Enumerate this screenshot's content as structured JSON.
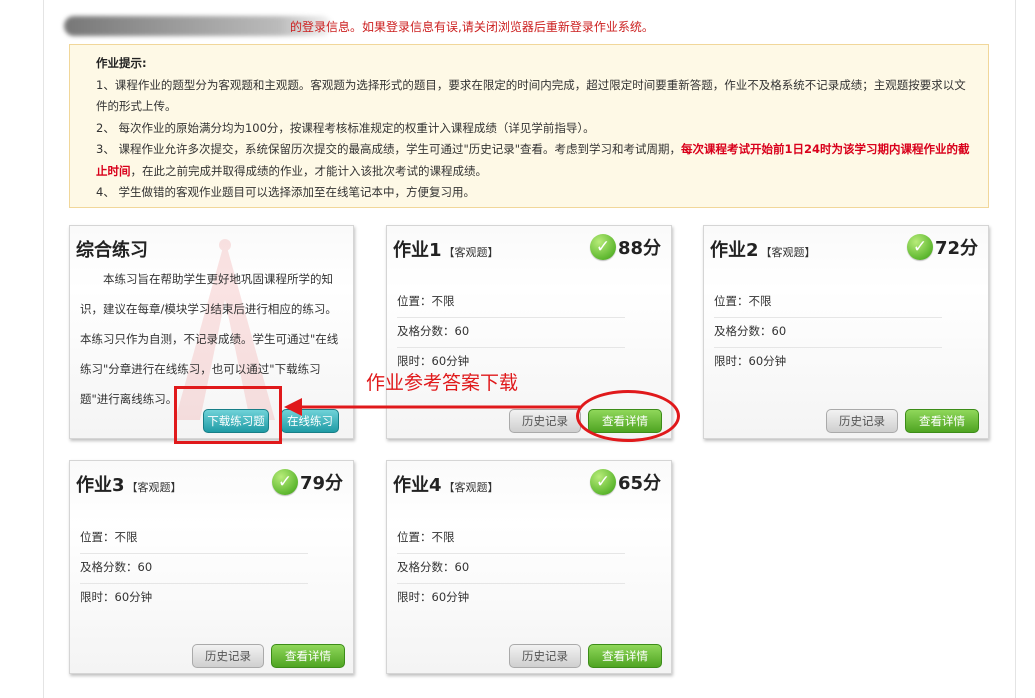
{
  "notice": {
    "visible_text": "的登录信息。如果登录信息有误,请关闭浏览器后重新登录作业系统。"
  },
  "tips": {
    "title": "作业提示:",
    "line1": "1、课程作业的题型分为客观题和主观题。客观题为选择形式的题目，要求在限定的时间内完成，超过限定时间要重新答题，作业不及格系统不记录成绩；主观题按要求以文件的形式上传。",
    "line2": "2、 每次作业的原始满分均为100分，按课程考核标准规定的权重计入课程成绩（详见学前指导）。",
    "line3_a": "3、 课程作业允许多次提交，系统保留历次提交的最高成绩，学生可通过\"历史记录\"查看。考虑到学习和考试周期，",
    "line3_red": "每次课程考试开始前1日24时为该学习期内课程作业的截止时间",
    "line3_b": "，在此之前完成并取得成绩的作业，才能计入该批次考试的课程成绩。",
    "line4": "4、 学生做错的客观作业题目可以选择添加至在线笔记本中，方便复习用。"
  },
  "practice": {
    "title": "综合练习",
    "description": "本练习旨在帮助学生更好地巩固课程所学的知识，建议在每章/模块学习结束后进行相应的练习。本练习只作为自测，不记录成绩。学生可通过\"在线练习\"分章进行在线练习，也可以通过\"下载练习题\"进行离线练习。",
    "download_label": "下载练习题",
    "online_label": "在线练习"
  },
  "labels": {
    "position": "位置：不限",
    "pass_score": "及格分数：60",
    "time_limit": "限时：60分钟",
    "history": "历史记录",
    "details": "查看详情",
    "check": "✓"
  },
  "assignments": [
    {
      "name": "作业1",
      "type": "【客观题】",
      "score": "88分"
    },
    {
      "name": "作业2",
      "type": "【客观题】",
      "score": "72分"
    },
    {
      "name": "作业3",
      "type": "【客观题】",
      "score": "79分"
    },
    {
      "name": "作业4",
      "type": "【客观题】",
      "score": "65分"
    }
  ],
  "annotation": {
    "text": "作业参考答案下载"
  },
  "colors": {
    "notice_red": "#cc2020",
    "tips_bg": "#fef9e6",
    "highlight_red": "#d9001b",
    "annotation_red": "#e0191b",
    "score_green": "#5fb830",
    "details_green": "#4fa422",
    "practice_teal": "#1f9ba5"
  }
}
